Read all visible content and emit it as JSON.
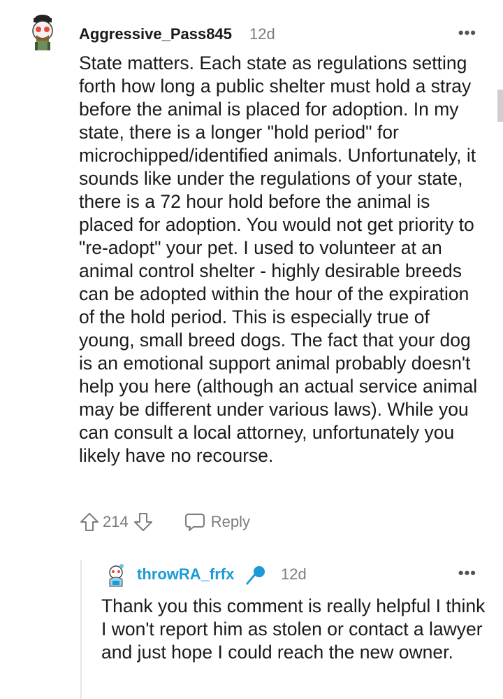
{
  "comment": {
    "username": "Aggressive_Pass845",
    "age": "12d",
    "more_icon": "more-horizontal-icon",
    "body": "State matters. Each state as regulations setting forth how long a public shelter must hold a stray before the animal is placed for adoption. In my state, there is a longer \"hold period\" for microchipped/identified animals. Unfortunately, it sounds like under the regulations of your state, there is a 72 hour hold before the animal is placed for adoption. You would not get priority to \"re-adopt\" your pet. I used to volunteer at an animal control shelter - highly desirable breeds can be adopted within the hour of the expiration of the hold period. This is especially true of young, small breed dogs. The fact that your dog is an emotional support animal probably doesn't help you here (although an actual service animal may be different under various laws). While you can consult a local attorney, unfortunately you likely have no recourse.",
    "votes": "214",
    "reply_label": "Reply"
  },
  "reply": {
    "username": "throwRA_frfx",
    "age": "12d",
    "body": "Thank you this comment is really helpful I think I won't report him as stolen or contact a lawyer and just hope I could reach the new owner."
  },
  "colors": {
    "username_reply": "#1a9bd6",
    "meta": "#7c7c7c",
    "text": "#1a1a1b"
  }
}
